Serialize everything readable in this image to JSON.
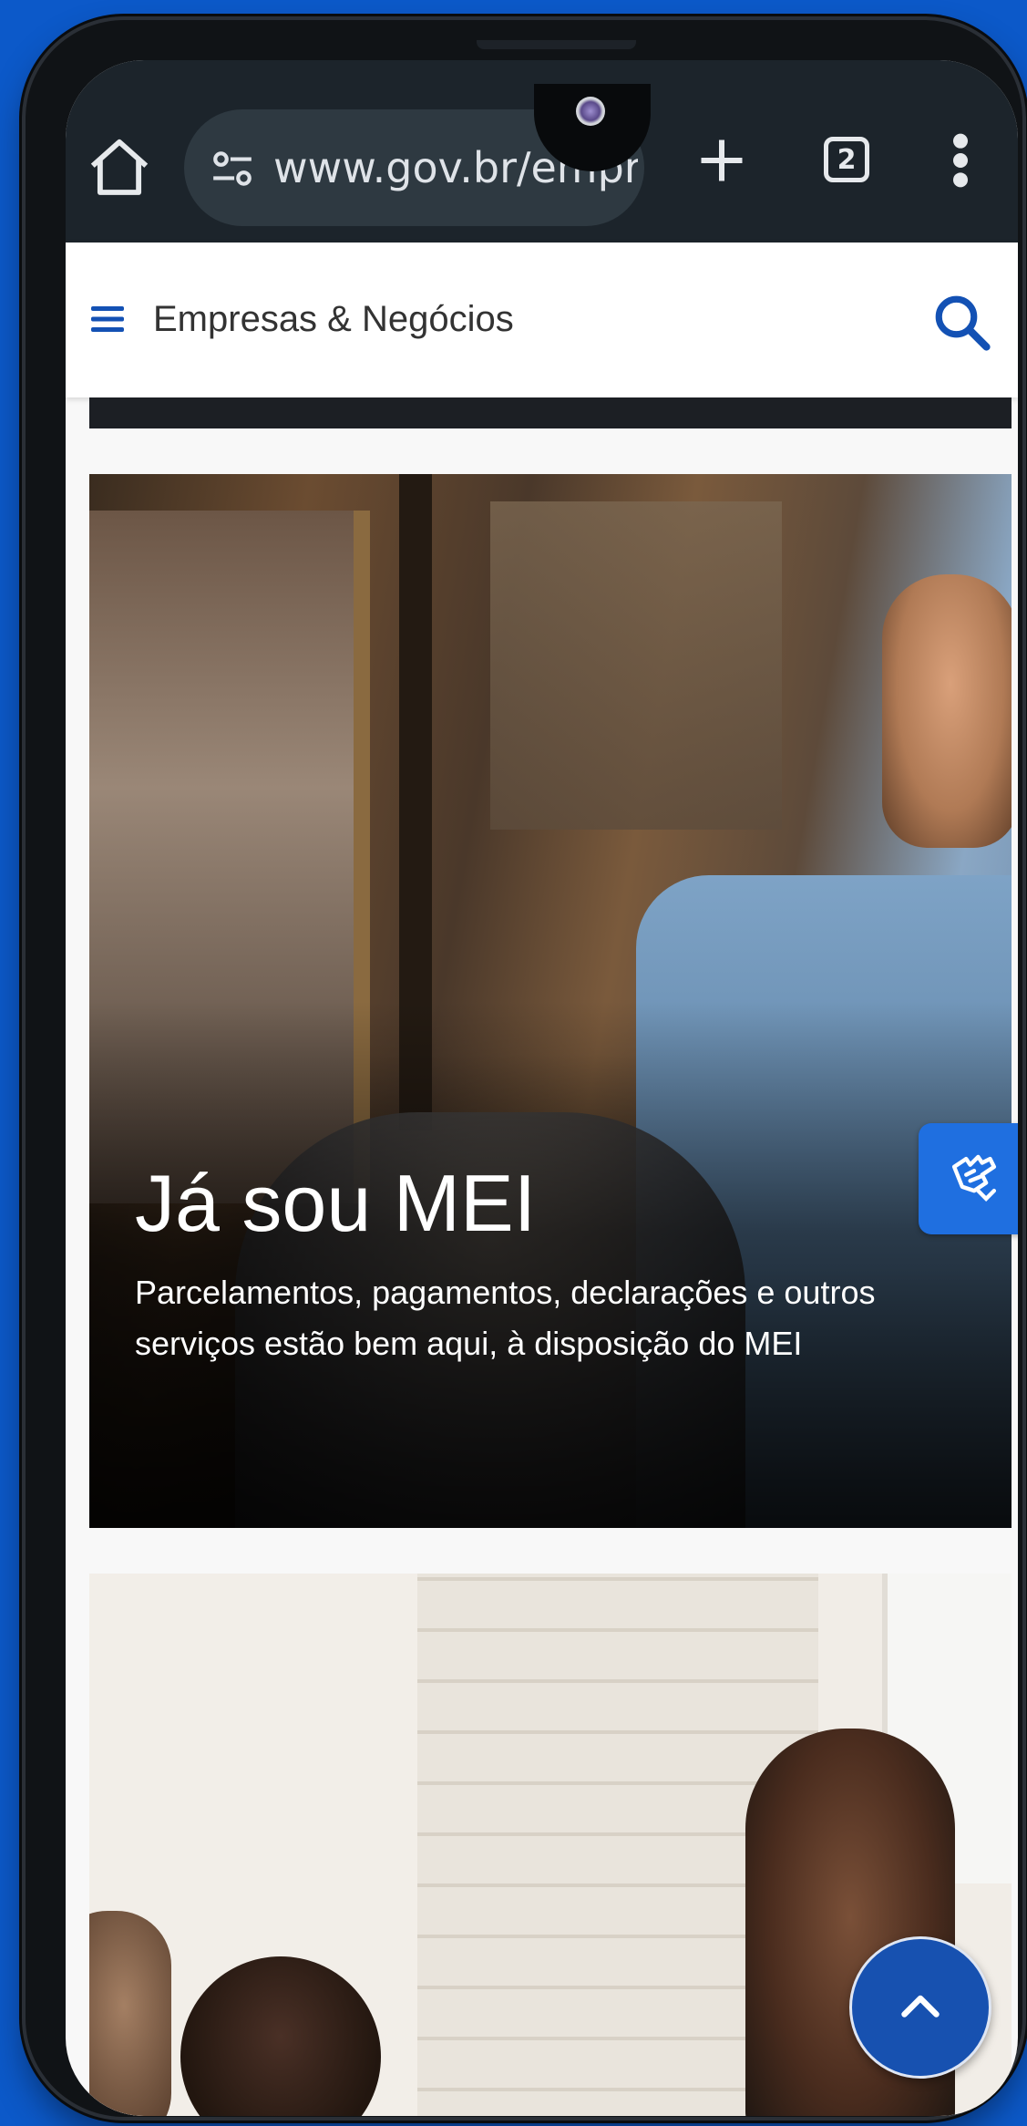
{
  "browser": {
    "url": "www.gov.br/empr",
    "tab_count": "2"
  },
  "site": {
    "title": "Empresas & Negócios"
  },
  "cards": [
    {
      "title": "Já sou MEI",
      "description": "Parcelamentos, pagamentos, declarações e outros serviços estão bem aqui, à disposição do MEI"
    }
  ],
  "colors": {
    "brand_blue": "#1351b4",
    "vlibras_blue": "#1f6fe0",
    "chrome_bg": "#1c242b",
    "background_blue": "#0c59c9"
  }
}
